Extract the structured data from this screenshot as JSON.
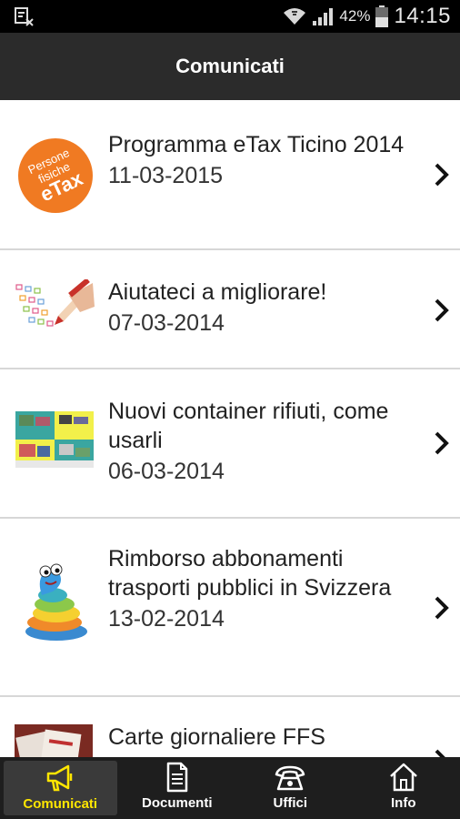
{
  "status_bar": {
    "battery_percent": "42%",
    "time": "14:15",
    "notification_icon": "sim-notification-icon"
  },
  "app_bar": {
    "title": "Comunicati"
  },
  "items": [
    {
      "title": "Programma eTax Ticino 2014",
      "date": "11-03-2015",
      "thumb": "etax-logo",
      "thumb_text": [
        "Persone",
        "fisiche",
        "eTax"
      ]
    },
    {
      "title": "Aiutateci a migliorare!",
      "date": "07-03-2014",
      "thumb": "survey-form-image"
    },
    {
      "title": "Nuovi container rifiuti, come usarli",
      "date": "06-03-2014",
      "thumb": "flyer-image"
    },
    {
      "title": "Rimborso abbonamenti trasporti pubblici in Svizzera",
      "date": "13-02-2014",
      "thumb": "snake-mascot-image"
    },
    {
      "title": "Carte giornaliere FFS",
      "date": "",
      "thumb": "tickets-image"
    }
  ],
  "bottom_nav": [
    {
      "label": "Comunicati",
      "icon": "megaphone-icon",
      "active": true
    },
    {
      "label": "Documenti",
      "icon": "document-icon",
      "active": false
    },
    {
      "label": "Uffici",
      "icon": "telephone-icon",
      "active": false
    },
    {
      "label": "Info",
      "icon": "home-icon",
      "active": false
    }
  ],
  "colors": {
    "accent": "#ffe600",
    "etax_orange": "#f07a22",
    "app_bar": "#2b2b2b"
  }
}
